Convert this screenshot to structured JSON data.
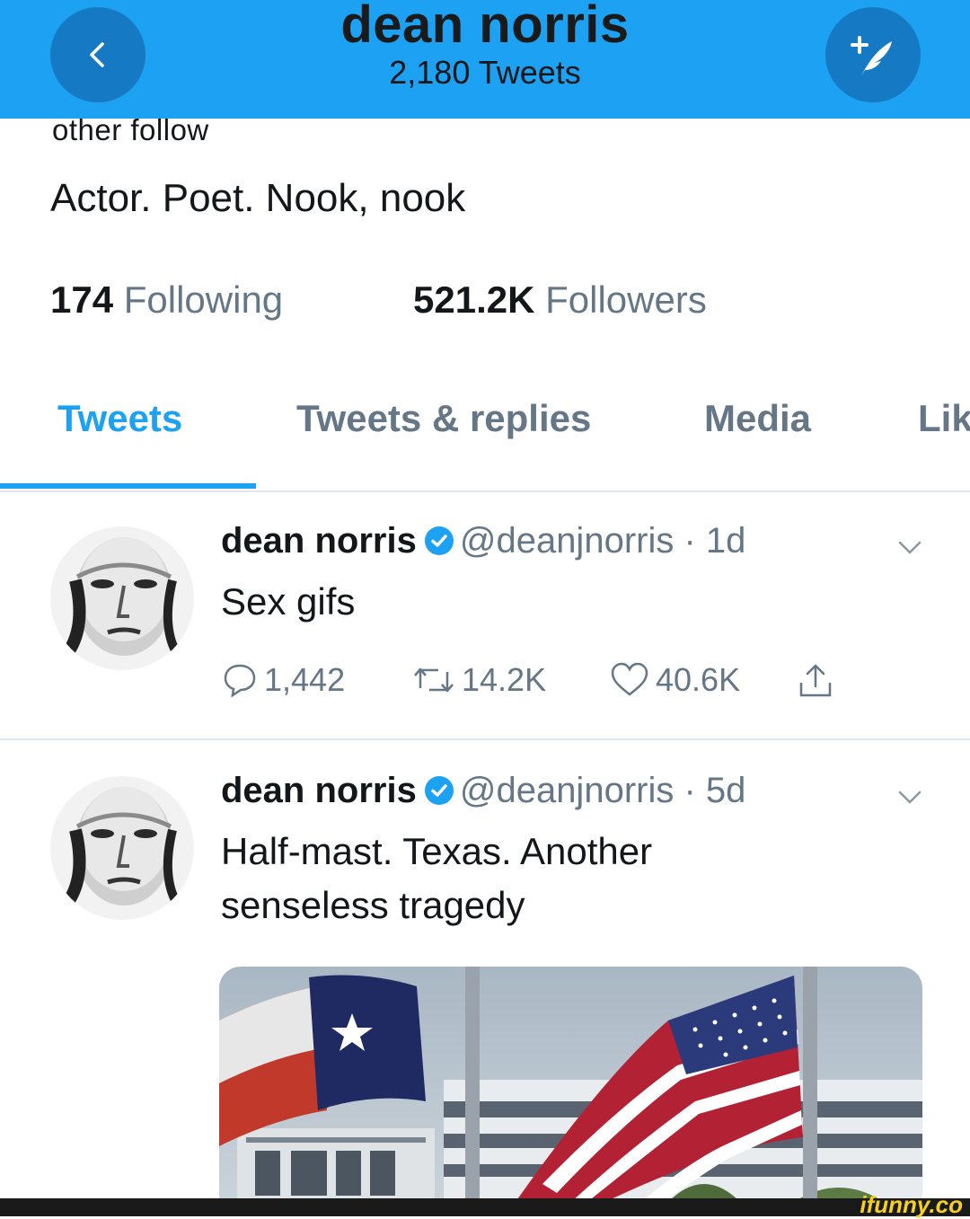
{
  "header": {
    "title": "dean norris",
    "tweet_count": "2,180 Tweets",
    "back_icon": "chevron-left-icon",
    "compose_icon": "compose-tweet-icon",
    "bg_color": "#1da1f2"
  },
  "profile": {
    "partial_text": "other follow",
    "bio": "Actor. Poet. Nook, nook",
    "following_count": "174",
    "following_label": "Following",
    "followers_count": "521.2K",
    "followers_label": "Followers"
  },
  "tabs": [
    {
      "label": "Tweets",
      "active": true
    },
    {
      "label": "Tweets & replies",
      "active": false
    },
    {
      "label": "Media",
      "active": false
    },
    {
      "label": "Lik",
      "active": false
    }
  ],
  "tweets": [
    {
      "name": "dean norris",
      "handle": "@deanjnorris",
      "time": "· 1d",
      "text": "Sex gifs",
      "replies": "1,442",
      "retweets": "14.2K",
      "likes": "40.6K"
    },
    {
      "name": "dean norris",
      "handle": "@deanjnorris",
      "time": "· 5d",
      "text_line1": "Half-mast. Texas. Another",
      "text_line2": "senseless tragedy"
    }
  ],
  "watermark": "ifunny.co",
  "colors": {
    "accent": "#1da1f2",
    "secondary_text": "#657786",
    "divider": "#e1e8ed"
  }
}
